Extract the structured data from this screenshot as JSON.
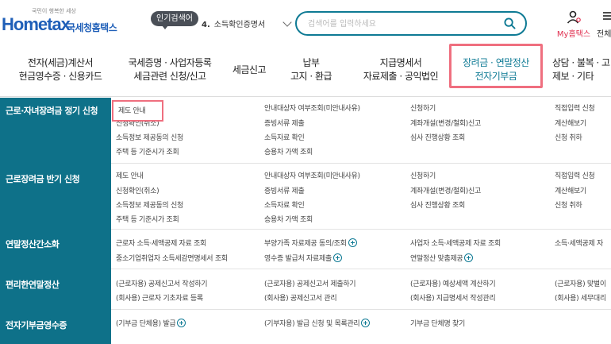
{
  "header": {
    "logo_tagline": "국민이 행복한 세상",
    "logo_wordmark": "Hometax",
    "logo_korean": "국세청홈택스",
    "popular_badge": "인기검색어",
    "popular_keyword": {
      "rank": "4.",
      "text": "소득확인증명서"
    },
    "search": {
      "placeholder": "검색어를 입력하세요"
    },
    "my_hometax": "My홈택스",
    "extra_link": "전체"
  },
  "gnb": [
    {
      "line1": "전자(세금)계산서",
      "line2": "현금영수증 · 신용카드"
    },
    {
      "line1": "국세증명 · 사업자등록",
      "line2": "세금관련 신청/신고"
    },
    {
      "line1": "세금신고",
      "line2": ""
    },
    {
      "line1": "납부",
      "line2": "고지 · 환급"
    },
    {
      "line1": "지급명세서",
      "line2": "자료제출 · 공익법인"
    },
    {
      "line1": "장려금 · 연말정산",
      "line2": "전자기부금"
    },
    {
      "line1": "상담 · 불복 · 고",
      "line2": "제보 · 기타"
    }
  ],
  "categories": [
    {
      "title": "근로·자녀장려금 정기 신청",
      "links": [
        [
          "제도 안내",
          "안내대상자 여부조회(미안내사유)",
          "신청하기",
          "직접입력 신청"
        ],
        [
          "신청확인(취소)",
          "증빙서류 제출",
          "계좌개설(변경/철회)신고",
          "계산해보기"
        ],
        [
          "소득정보 제공동의 신청",
          "소득자료 확인",
          "심사 진행상황 조회",
          "신청 취하"
        ],
        [
          "주택 등 기준시가 조회",
          "승용차 가액 조회",
          "",
          ""
        ]
      ]
    },
    {
      "title": "근로장려금 반기 신청",
      "links": [
        [
          "제도 안내",
          "안내대상자 여부조회(미안내사유)",
          "신청하기",
          "직접입력 신청"
        ],
        [
          "신청확인(취소)",
          "증빙서류 제출",
          "계좌개설(변경/철회)신고",
          "계산해보기"
        ],
        [
          "소득정보 제공동의 신청",
          "소득자료 확인",
          "심사 진행상황 조회",
          "신청 취하"
        ],
        [
          "주택 등 기준시가 조회",
          "승용차 가액 조회",
          "",
          ""
        ]
      ]
    },
    {
      "title": "연말정산간소화",
      "links": [
        [
          "근로자 소득·세액공제 자료 조회",
          "부양가족 자료제공 동의/조회",
          "사업자 소득·세액공제 자료 조회",
          "소득·세액공제 자"
        ],
        [
          "중소기업취업자 소득세감면명세서 조회",
          "영수증 발급처 자료제출",
          "연말정산 맞춤제공",
          ""
        ]
      ]
    },
    {
      "title": "편리한연말정산",
      "links": [
        [
          "(근로자용) 공제신고서 작성하기",
          "(근로자용) 공제신고서 제출하기",
          "(근로자용) 예상세액 계산하기",
          "(근로자용) 맞벌이"
        ],
        [
          "(회사용) 근로자 기초자료 등록",
          "(회사용) 공제신고서 관리",
          "(회사용) 지급명세서 작성관리",
          "(회사용) 세무대리"
        ]
      ]
    },
    {
      "title": "전자기부금영수증",
      "links": [
        [
          "(기부금 단체용) 발급",
          "(기부자용) 발급 신청 및 목록관리",
          "기부금 단체명 찾기",
          ""
        ]
      ]
    }
  ],
  "colors": {
    "brand": "#1f5fb8",
    "side_panel": "#0e7189",
    "highlight": "#ef6f7f",
    "accent": "#0e7a94"
  }
}
